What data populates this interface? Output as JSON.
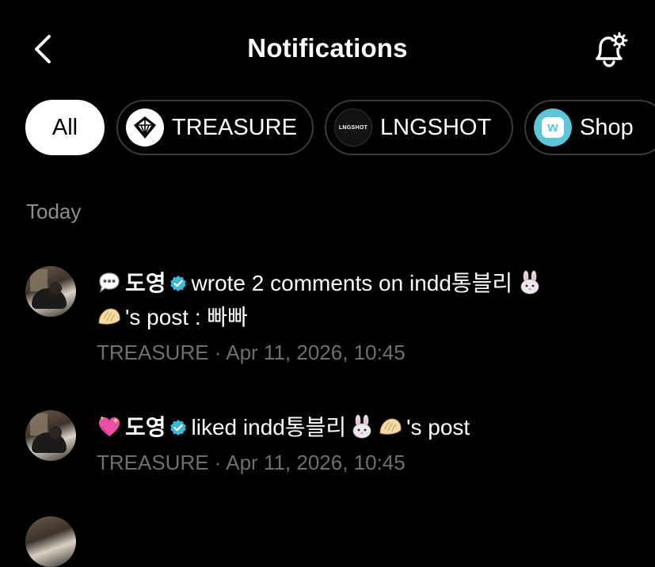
{
  "header": {
    "title": "Notifications",
    "back_icon": "chevron-left-icon",
    "settings_icon": "bell-settings-icon"
  },
  "filters": [
    {
      "label": "All",
      "active": true
    },
    {
      "label": "TREASURE",
      "icon": "treasure-logo-icon"
    },
    {
      "label": "LNGSHOT",
      "icon": "lngshot-logo-icon",
      "logo_text": "LNGSHOT"
    },
    {
      "label": "Shop",
      "icon": "shop-logo-icon",
      "logo_text": "w"
    }
  ],
  "section": {
    "title": "Today"
  },
  "notifications": [
    {
      "emoji": "speech-bubble-icon",
      "author": "도영",
      "pre_text": "wrote 2 comments on indd통블리",
      "post_suffix": "'s post : 빠빠",
      "source": "TREASURE",
      "separator": " · ",
      "time": "Apr 11, 2026, 10:45"
    },
    {
      "emoji": "sparkling-heart-icon",
      "author": "도영",
      "pre_text": "liked indd통블리",
      "post_suffix": "'s post",
      "source": "TREASURE",
      "separator": " · ",
      "time": "Apr 11, 2026, 10:45"
    }
  ],
  "colors": {
    "background": "#000000",
    "text": "#ffffff",
    "muted": "#8e8e93",
    "meta": "#6f6f73",
    "verified": "#3fb7d8",
    "shop": "#5ec4d8"
  }
}
